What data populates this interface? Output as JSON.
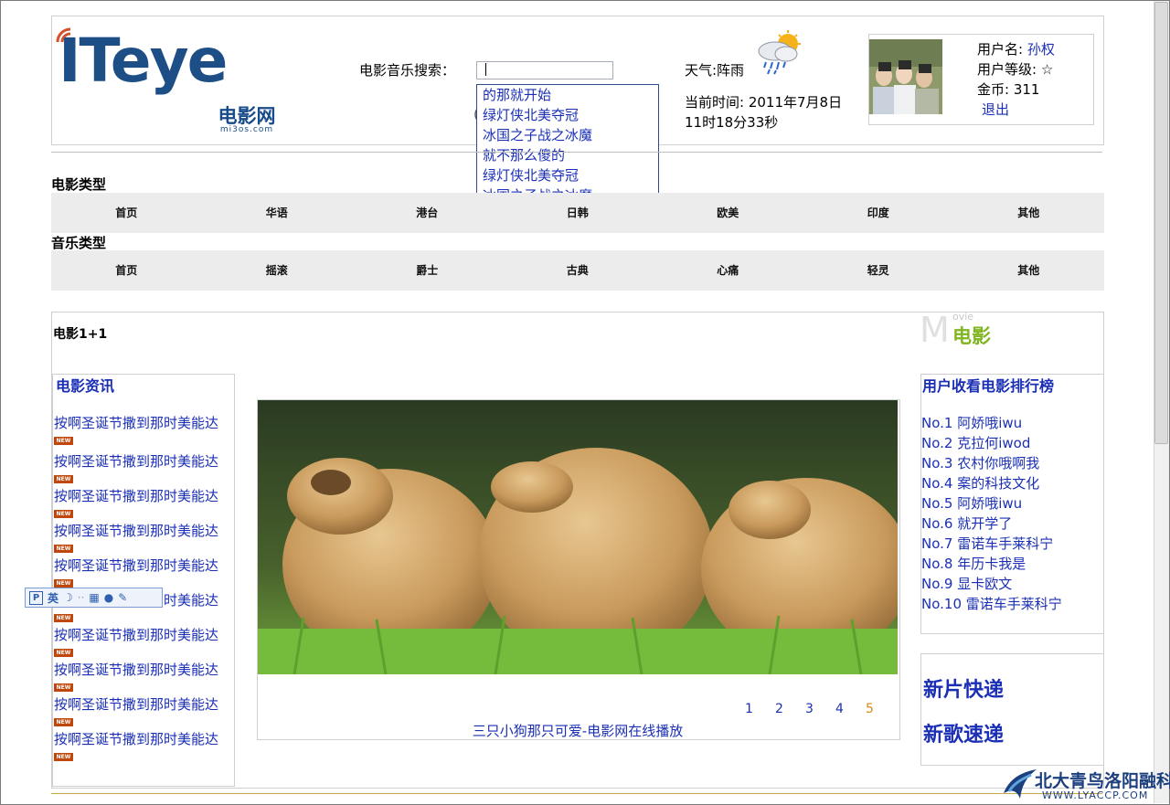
{
  "header": {
    "logo_text": "ITeye",
    "sub_logo_cn": "电影网",
    "sub_logo_en": "mi3os.com",
    "search_label": "电影音乐搜索：",
    "search_value": "",
    "suggestions": [
      "的那就开始",
      "绿灯侠北美夺冠",
      "冰国之子战之冰魔",
      "就不那么傻的",
      "绿灯侠北美夺冠",
      "冰国之子战之冰魔"
    ],
    "weather_label": "天气:阵雨",
    "time_line1": "当前时间: 2011年7月8日",
    "time_line2": "11时18分33秒",
    "user": {
      "name_label": "用户名:",
      "name": "孙权",
      "level_label": "用户等级:",
      "level": "☆",
      "coins_label": "金币:",
      "coins": "311",
      "logout": "退出"
    }
  },
  "movie_types": {
    "title": "电影类型",
    "items": [
      "首页",
      "华语",
      "港台",
      "日韩",
      "欧美",
      "印度",
      "其他"
    ]
  },
  "music_types": {
    "title": "音乐类型",
    "items": [
      "首页",
      "摇滚",
      "爵士",
      "古典",
      "心痛",
      "轻灵",
      "其他"
    ]
  },
  "main": {
    "section_title": "电影1+1",
    "badge_big": "M",
    "badge_small": "ovie",
    "badge_cn": "电影",
    "news_title": "电影资讯",
    "new_tag": "NEW",
    "news": [
      "按啊圣诞节撒到那时美能达",
      "按啊圣诞节撒到那时美能达",
      "按啊圣诞节撒到那时美能达",
      "按啊圣诞节撒到那时美能达",
      "按啊圣诞节撒到那时美能达",
      "按啊圣诞节撒到那时美能达",
      "按啊圣诞节撒到那时美能达",
      "按啊圣诞节撒到那时美能达",
      "按啊圣诞节撒到那时美能达",
      "按啊圣诞节撒到那时美能达"
    ],
    "pager": [
      "1",
      "2",
      "3",
      "4",
      "5"
    ],
    "pager_current": "5",
    "caption": "三只小狗那只可爱-电影网在线播放",
    "rank_title": "用户收看电影排行榜",
    "ranks": [
      "No.1 阿娇哦iwu",
      "No.2 克拉何iwod",
      "No.3 农村你哦啊我",
      "No.4 案的科技文化",
      "No.5 阿娇哦iwu",
      "No.6 就开学了",
      "No.7 雷诺车手莱科宁",
      "No.8 年历卡我是",
      "No.9 显卡欧文",
      "No.10 雷诺车手莱科宁"
    ],
    "quick1": "新片快递",
    "quick2": "新歌速递"
  },
  "ime": {
    "lang": "英"
  },
  "watermark": {
    "cn": "北大青鸟洛阳融科",
    "en": "WWW.LYACCP.COM"
  }
}
